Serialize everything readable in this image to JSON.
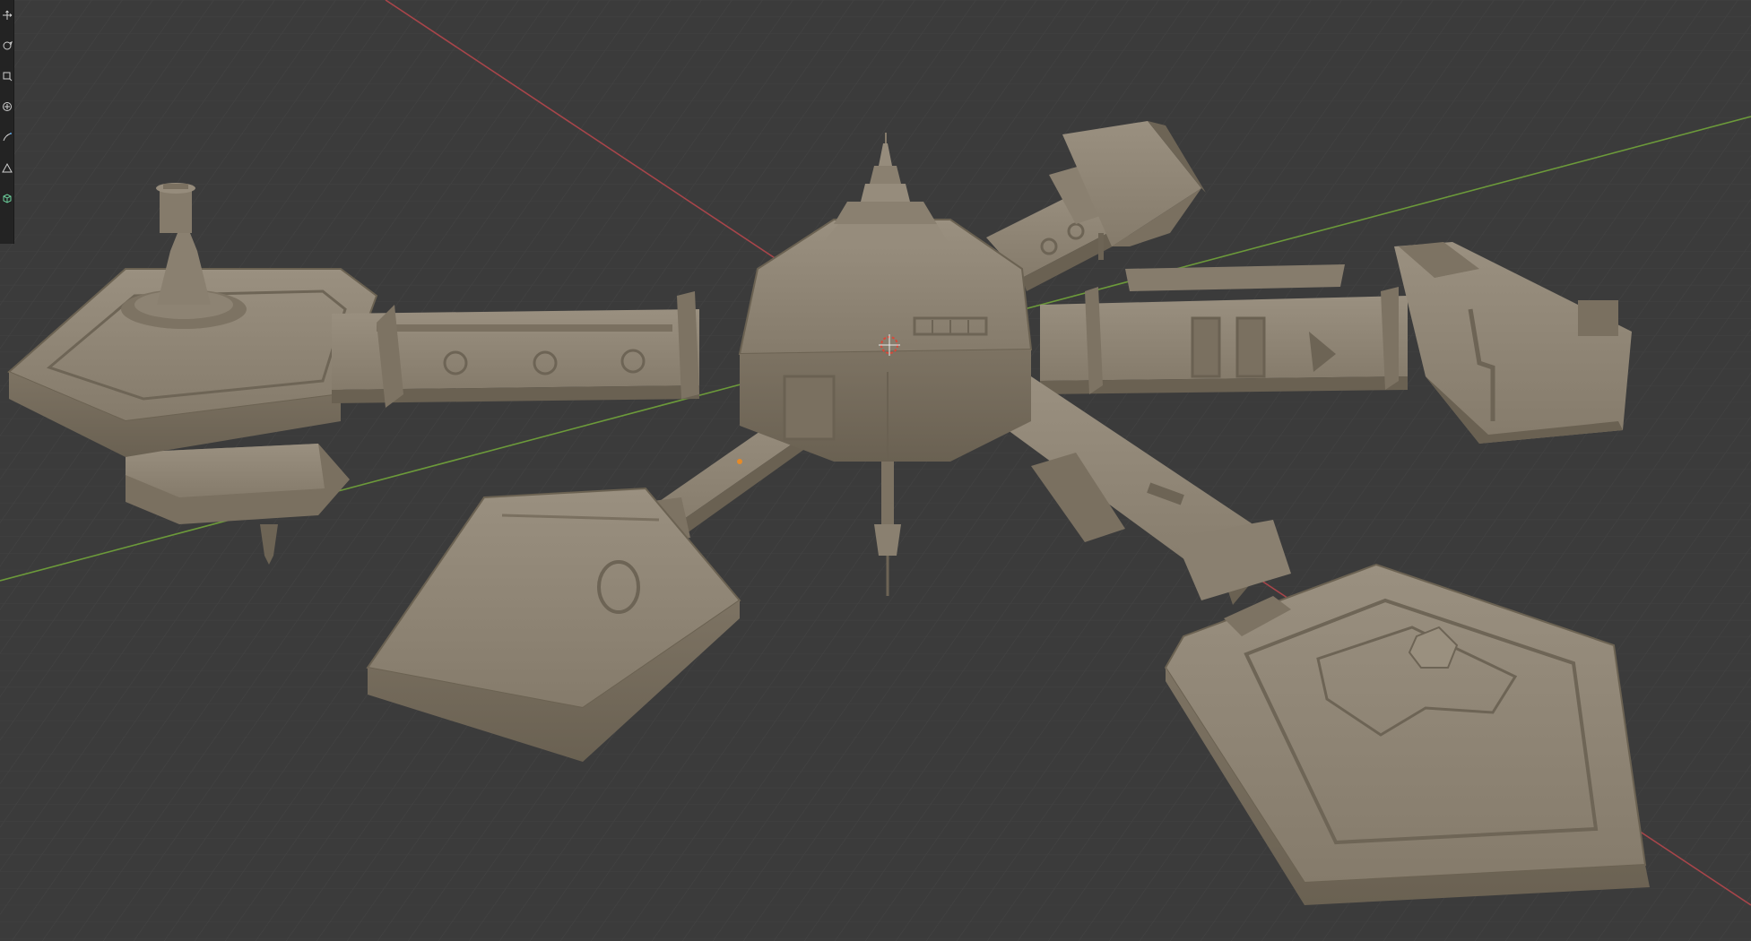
{
  "app": {
    "accent_color": "#5a9bd8",
    "background_color": "#3b3b3b",
    "model_color": "#8e8474"
  },
  "toolbar": {
    "tools": [
      {
        "name": "move-tool",
        "icon": "move-arrows-icon"
      },
      {
        "name": "rotate-tool",
        "icon": "rotate-icon"
      },
      {
        "name": "scale-tool",
        "icon": "scale-box-icon"
      },
      {
        "name": "transform-tool",
        "icon": "transform-icon"
      },
      {
        "name": "annotate-tool",
        "icon": "annotate-pen-icon"
      },
      {
        "name": "measure-tool",
        "icon": "measure-ruler-icon"
      },
      {
        "name": "add-cube-tool",
        "icon": "add-cube-icon"
      }
    ]
  },
  "viewport": {
    "axes": {
      "x_axis_color": "#a8454a",
      "y_axis_color": "#6c9a3a"
    }
  }
}
